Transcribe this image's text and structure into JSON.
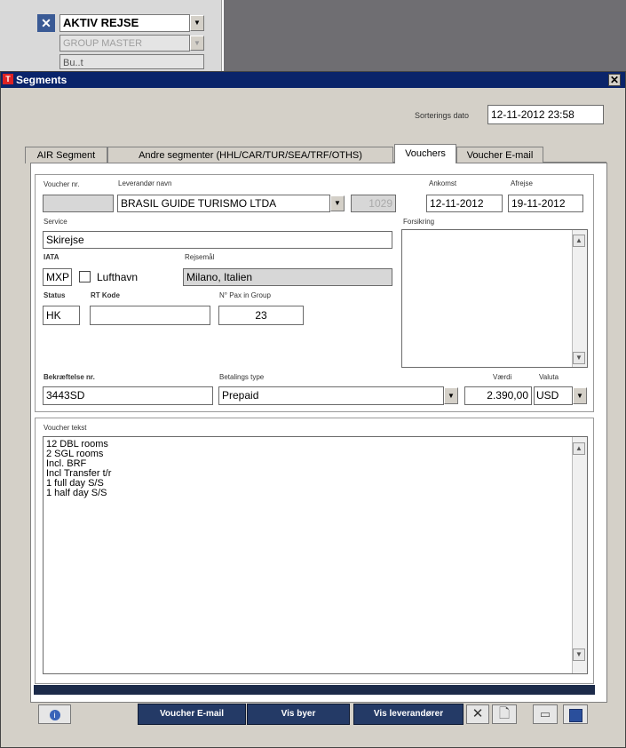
{
  "background_window": {
    "status_value": "AKTIV REJSE",
    "group_value": "GROUP MASTER",
    "third_value": "Bu..t"
  },
  "dialog": {
    "title": "Segments",
    "sort_label": "Sorterings dato",
    "sort_value": "12-11-2012 23:58",
    "tabs": [
      {
        "label": "AIR Segment"
      },
      {
        "label": "Andre segmenter (HHL/CAR/TUR/SEA/TRF/OTHS)"
      },
      {
        "label": "Vouchers"
      },
      {
        "label": "Voucher E-mail"
      }
    ],
    "voucher": {
      "voucher_nr_label": "Voucher nr.",
      "voucher_nr_value": "",
      "supplier_label": "Leverandør navn",
      "supplier_value": "BRASIL GUIDE TURISMO LTDA",
      "supplier_code": "1029",
      "arrival_label": "Ankomst",
      "arrival_value": "12-11-2012",
      "departure_label": "Afrejse",
      "departure_value": "19-11-2012",
      "service_label": "Service",
      "service_value": "Skirejse",
      "notes_label": "Forsikring",
      "iata_label": "IATA",
      "iata_value": "MXP",
      "airport_label": "Lufthavn",
      "destination_label": "Rejsemål",
      "destination_value": "Milano, Italien",
      "status_label": "Status",
      "status_value": "HK",
      "rt_label": "RT Kode",
      "rt_value": "",
      "pax_label": "N° Pax in Group",
      "pax_value": "23",
      "confirmation_label": "Bekræftelse nr.",
      "confirmation_value": "3443SD",
      "payment_label": "Betalings type",
      "payment_value": "Prepaid",
      "value_label": "Værdi",
      "value_value": "2.390,00",
      "currency_label": "Valuta",
      "currency_value": "USD",
      "text_label": "Voucher tekst",
      "text_lines": [
        "12 DBL rooms",
        "2 SGL rooms",
        "Incl. BRF",
        "Incl Transfer t/r",
        "1 full day S/S",
        "1 half day S/S"
      ]
    },
    "buttons": {
      "email": "Voucher E-mail",
      "cities": "Vis byer",
      "suppliers": "Vis leverandører"
    }
  },
  "colors": {
    "titlebar": "#0a246a",
    "nav_button": "#243a66",
    "dialog_bg": "#d4d0c8"
  }
}
